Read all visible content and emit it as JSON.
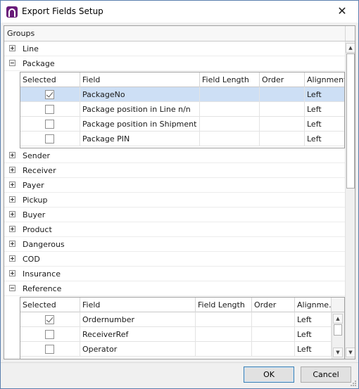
{
  "window": {
    "title": "Export Fields Setup",
    "close_glyph": "✕"
  },
  "grid": {
    "header": "Groups"
  },
  "groups": [
    {
      "label": "Line",
      "expanded": false
    },
    {
      "label": "Package",
      "expanded": true
    },
    {
      "label": "Sender",
      "expanded": false
    },
    {
      "label": "Receiver",
      "expanded": false
    },
    {
      "label": "Payer",
      "expanded": false
    },
    {
      "label": "Pickup",
      "expanded": false
    },
    {
      "label": "Buyer",
      "expanded": false
    },
    {
      "label": "Product",
      "expanded": false
    },
    {
      "label": "Dangerous",
      "expanded": false
    },
    {
      "label": "COD",
      "expanded": false
    },
    {
      "label": "Insurance",
      "expanded": false
    },
    {
      "label": "Reference",
      "expanded": true
    }
  ],
  "package_table": {
    "columns": [
      "Selected",
      "Field",
      "Field Length",
      "Order",
      "Alignment"
    ],
    "rows": [
      {
        "selected": true,
        "field": "PackageNo",
        "length": "",
        "order": "",
        "alignment": "Left"
      },
      {
        "selected": false,
        "field": "Package position in Line n/n",
        "length": "",
        "order": "",
        "alignment": "Left"
      },
      {
        "selected": false,
        "field": "Package position in Shipment n/n",
        "length": "",
        "order": "",
        "alignment": "Left"
      },
      {
        "selected": false,
        "field": "Package PIN",
        "length": "",
        "order": "",
        "alignment": "Left"
      }
    ]
  },
  "reference_table": {
    "columns": [
      "Selected",
      "Field",
      "Field Length",
      "Order",
      "Alignme..."
    ],
    "rows": [
      {
        "selected": true,
        "field": "Ordernumber",
        "length": "",
        "order": "",
        "alignment": "Left"
      },
      {
        "selected": false,
        "field": "ReceiverRef",
        "length": "",
        "order": "",
        "alignment": "Left"
      },
      {
        "selected": false,
        "field": "Operator",
        "length": "",
        "order": "",
        "alignment": "Left"
      }
    ]
  },
  "buttons": {
    "ok": "OK",
    "cancel": "Cancel"
  },
  "icons": {
    "app": "app-logo-icon",
    "close": "close-icon",
    "expand": "plus-box-icon",
    "collapse": "minus-box-icon",
    "scroll_up": "chevron-up-icon",
    "scroll_down": "chevron-down-icon"
  },
  "colors": {
    "selection": "#cddff5",
    "border": "#a0a0a0",
    "app_icon": "#6a1b7a"
  }
}
